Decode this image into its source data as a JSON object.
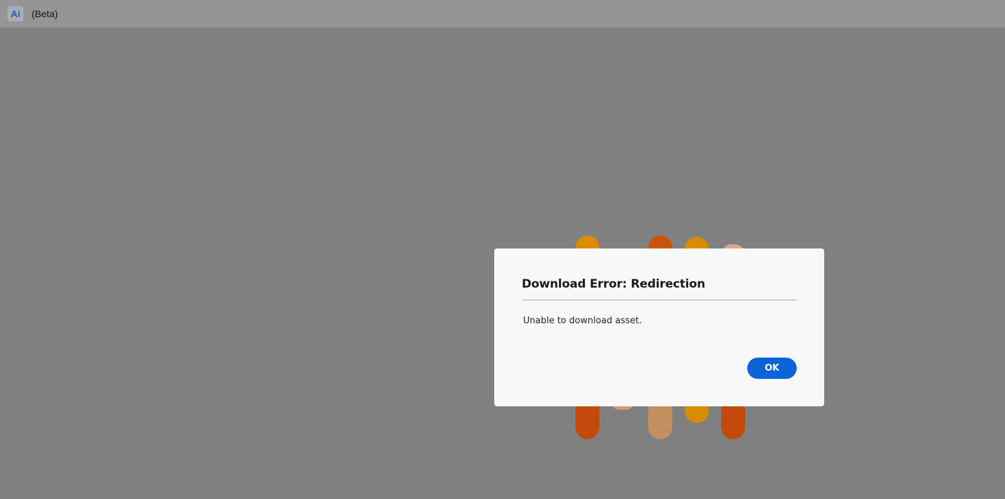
{
  "titlebar": {
    "app_icon_label": "Ai",
    "app_icon_color": "#1f5bbd",
    "beta_label": "(Beta)"
  },
  "splash": {
    "colors": [
      "#d98c00",
      "#c9550a",
      "#e3a16a",
      "#d99a60",
      "#f0b894"
    ]
  },
  "dialog": {
    "title": "Download Error: Redirection",
    "message": "Unable to download asset.",
    "ok_label": "OK",
    "ok_color": "#0a64d8"
  }
}
